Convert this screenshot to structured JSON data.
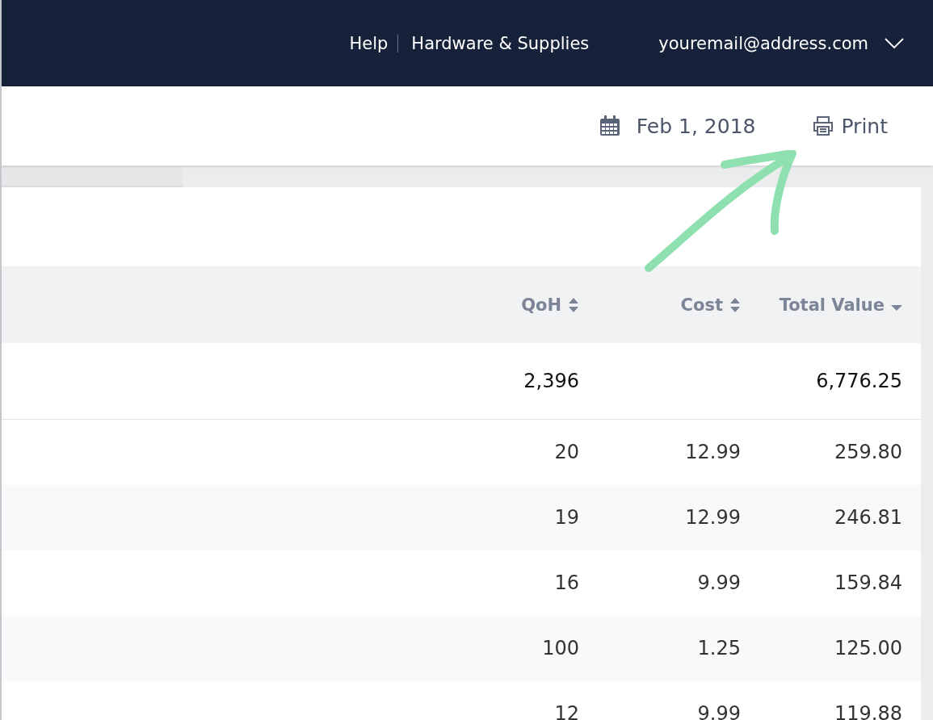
{
  "top_bar": {
    "links": [
      "Help",
      "Hardware & Supplies"
    ],
    "account": "youremail@address.com"
  },
  "toolbar": {
    "date": "Feb 1, 2018",
    "print": "Print"
  },
  "table": {
    "columns": [
      {
        "label": "QoH",
        "kind": "sortable"
      },
      {
        "label": "Cost",
        "kind": "sortable"
      },
      {
        "label": "Total Value",
        "kind": "sorted"
      }
    ],
    "rows": [
      {
        "kind": "total",
        "cells": [
          "2,396",
          "",
          "6,776.25"
        ]
      },
      {
        "kind": "item",
        "cells": [
          "20",
          "12.99",
          "259.80"
        ]
      },
      {
        "kind": "item",
        "cells": [
          "19",
          "12.99",
          "246.81"
        ]
      },
      {
        "kind": "item",
        "cells": [
          "16",
          "9.99",
          "159.84"
        ]
      },
      {
        "kind": "item",
        "cells": [
          "100",
          "1.25",
          "125.00"
        ]
      },
      {
        "kind": "item",
        "cells": [
          "12",
          "9.99",
          "119.88"
        ]
      }
    ]
  }
}
